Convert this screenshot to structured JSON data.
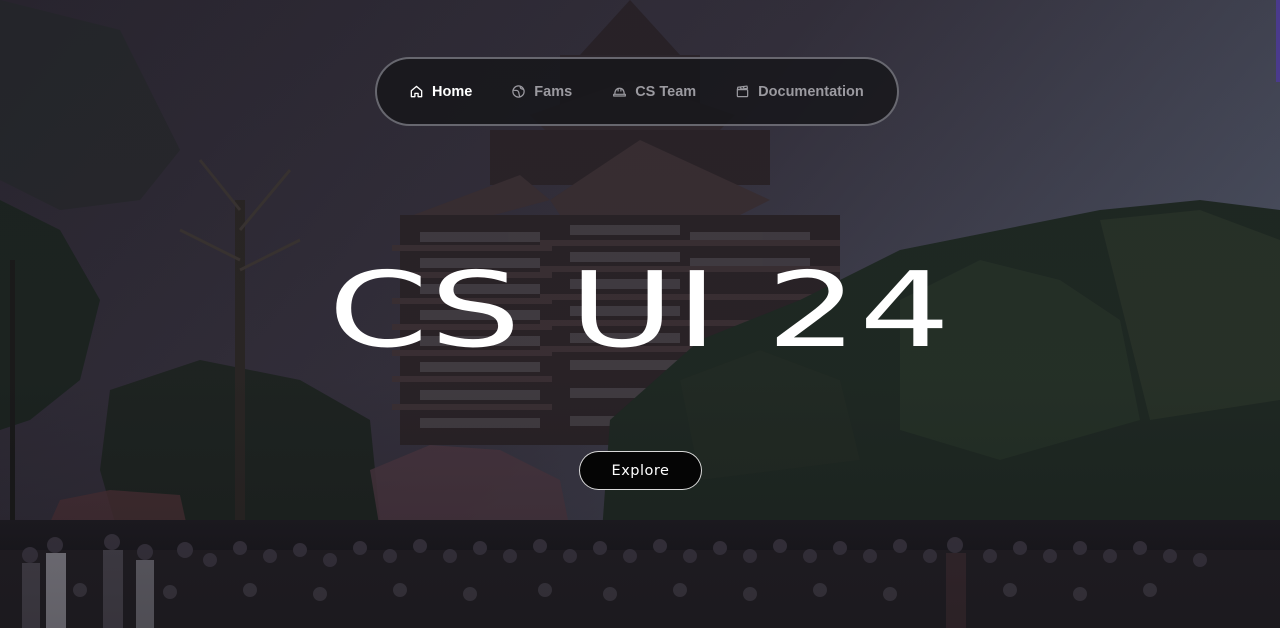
{
  "nav": {
    "items": [
      {
        "label": "Home",
        "icon": "home-icon",
        "active": true
      },
      {
        "label": "Fams",
        "icon": "globe-icon",
        "active": false
      },
      {
        "label": "CS Team",
        "icon": "helmet-icon",
        "active": false
      },
      {
        "label": "Documentation",
        "icon": "clapperboard-icon",
        "active": false
      }
    ]
  },
  "hero": {
    "title": "CS UI 24",
    "explore_label": "Explore"
  },
  "colors": {
    "nav_background": "#161619",
    "nav_active_text": "#ffffff",
    "nav_inactive_text": "#9b9aa0",
    "button_background": "#050505",
    "title_color": "#ffffff"
  }
}
